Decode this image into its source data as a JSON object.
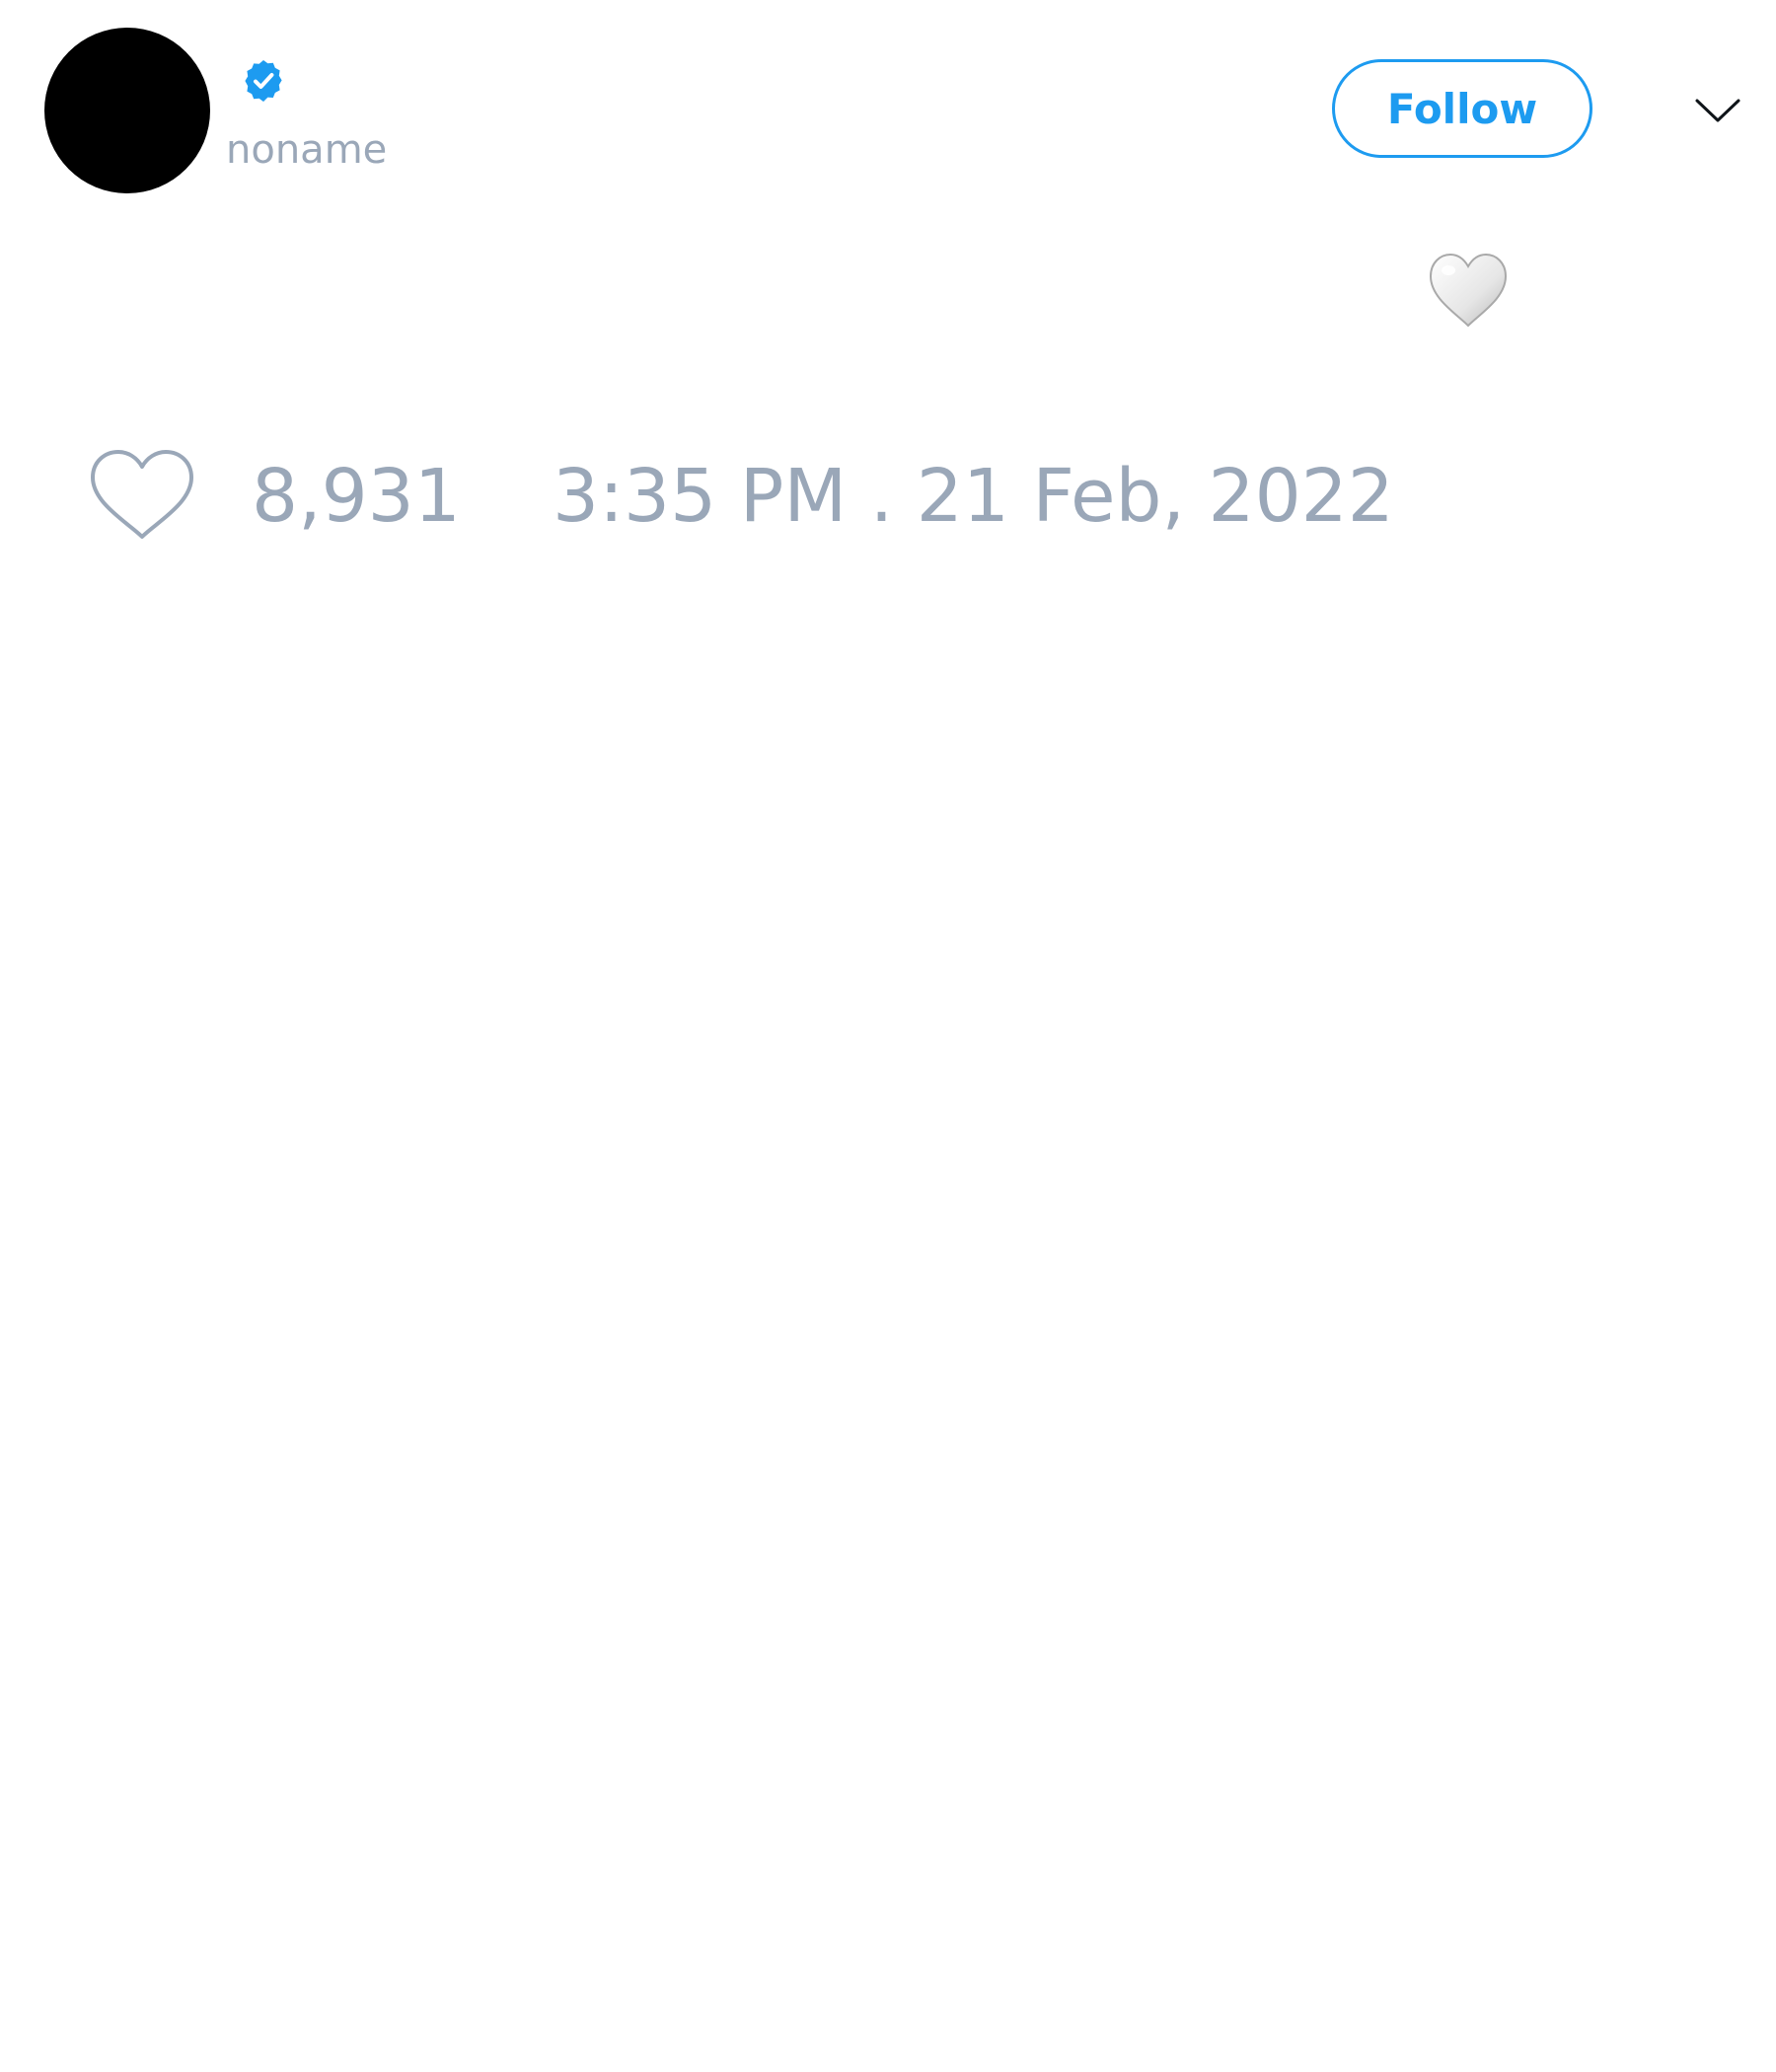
{
  "tweet": {
    "author": {
      "avatar_color": "#000000",
      "verified_icon": "verified-badge-icon",
      "handle": "noname"
    },
    "follow_label": "Follow",
    "menu_icon": "chevron-down-icon",
    "content_icon": "white-heart-emoji-icon",
    "likes": "8,931",
    "like_icon": "heart-outline-icon",
    "timestamp": "3:35 PM . 21 Feb, 2022"
  },
  "colors": {
    "accent": "#1d9bf0",
    "muted_text": "#9aa7b8"
  }
}
